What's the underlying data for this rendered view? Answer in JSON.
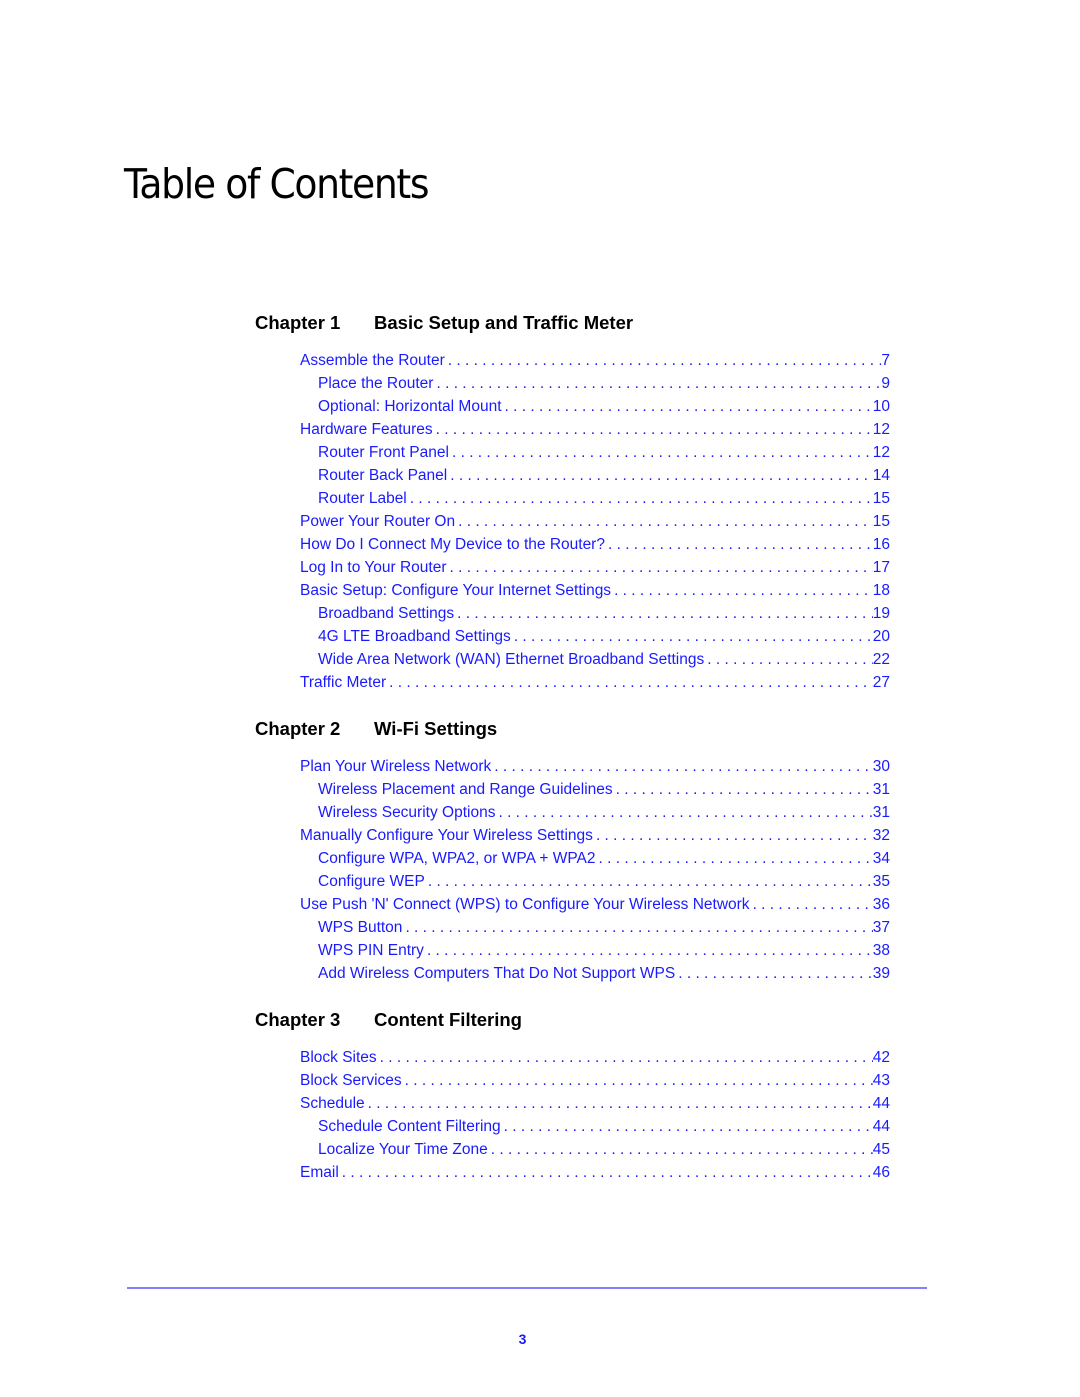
{
  "title": "Table of Contents",
  "chapters": [
    {
      "number": "Chapter 1",
      "title": "Basic Setup and Traffic Meter",
      "entries": [
        {
          "label": "Assemble the Router",
          "page": "7",
          "level": 1
        },
        {
          "label": "Place the Router",
          "page": "9",
          "level": 2
        },
        {
          "label": "Optional: Horizontal Mount",
          "page": "10",
          "level": 2
        },
        {
          "label": "Hardware Features",
          "page": "12",
          "level": 1
        },
        {
          "label": "Router Front Panel",
          "page": "12",
          "level": 2
        },
        {
          "label": "Router Back Panel",
          "page": "14",
          "level": 2
        },
        {
          "label": "Router Label",
          "page": "15",
          "level": 2
        },
        {
          "label": "Power Your Router On",
          "page": "15",
          "level": 1
        },
        {
          "label": "How Do I Connect My Device to the Router?",
          "page": "16",
          "level": 1
        },
        {
          "label": "Log In to Your Router",
          "page": "17",
          "level": 1
        },
        {
          "label": "Basic Setup: Configure Your Internet Settings",
          "page": "18",
          "level": 1
        },
        {
          "label": "Broadband Settings",
          "page": "19",
          "level": 2
        },
        {
          "label": "4G LTE Broadband Settings",
          "page": "20",
          "level": 2
        },
        {
          "label": "Wide Area Network (WAN) Ethernet Broadband Settings",
          "page": "22",
          "level": 2
        },
        {
          "label": "Traffic Meter",
          "page": "27",
          "level": 1
        }
      ]
    },
    {
      "number": "Chapter 2",
      "title": "Wi-Fi Settings",
      "entries": [
        {
          "label": "Plan Your Wireless Network",
          "page": "30",
          "level": 1
        },
        {
          "label": "Wireless Placement and Range Guidelines",
          "page": "31",
          "level": 2
        },
        {
          "label": "Wireless Security Options",
          "page": "31",
          "level": 2
        },
        {
          "label": "Manually Configure Your Wireless Settings",
          "page": "32",
          "level": 1
        },
        {
          "label": "Configure WPA, WPA2, or WPA + WPA2",
          "page": "34",
          "level": 2
        },
        {
          "label": "Configure WEP",
          "page": "35",
          "level": 2
        },
        {
          "label": "Use Push 'N' Connect (WPS) to Configure Your Wireless Network",
          "page": "36",
          "level": 1
        },
        {
          "label": "WPS Button",
          "page": "37",
          "level": 2
        },
        {
          "label": "WPS PIN Entry",
          "page": "38",
          "level": 2
        },
        {
          "label": "Add Wireless Computers That Do Not Support WPS",
          "page": "39",
          "level": 2
        }
      ]
    },
    {
      "number": "Chapter 3",
      "title": "Content Filtering",
      "entries": [
        {
          "label": "Block Sites",
          "page": "42",
          "level": 1
        },
        {
          "label": "Block Services",
          "page": "43",
          "level": 1
        },
        {
          "label": "Schedule",
          "page": "44",
          "level": 1
        },
        {
          "label": "Schedule Content Filtering",
          "page": "44",
          "level": 2
        },
        {
          "label": "Localize Your Time Zone",
          "page": "45",
          "level": 2
        },
        {
          "label": "Email",
          "page": "46",
          "level": 1
        }
      ]
    }
  ],
  "footer": {
    "page_number": "3"
  },
  "colors": {
    "link": "#1a1aff",
    "rule": "#8080ff",
    "heading": "#000000"
  }
}
